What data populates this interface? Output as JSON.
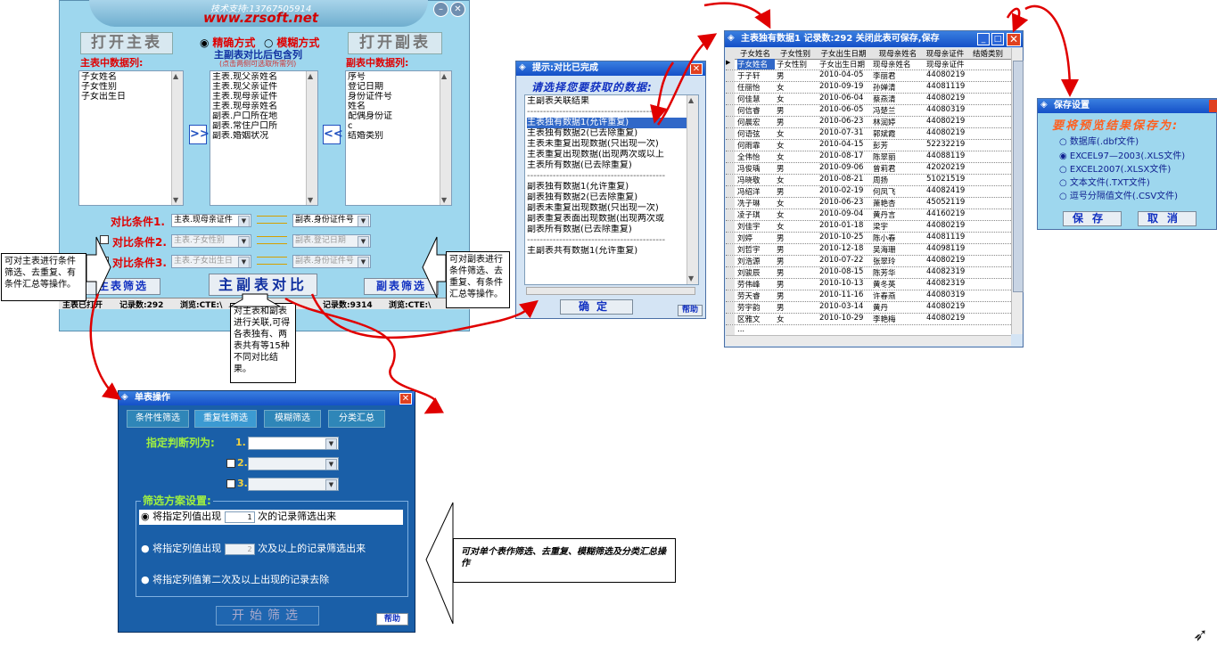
{
  "main": {
    "support_text": "技术支持:13767505914",
    "website": "www.zrsoft.net",
    "open_main": "打开主表",
    "open_sub": "打开副表",
    "mode_exact": "精确方式",
    "mode_fuzzy": "模糊方式",
    "main_cols_label": "主表中数据列:",
    "sub_cols_label": "副表中数据列:",
    "center_label": "主副表对比后包含列",
    "center_hint": "(点击两侧可选取所需列)",
    "main_cols": [
      "子女姓名",
      "子女性别",
      "子女出生日"
    ],
    "center_cols": [
      "主表.现父亲姓名",
      "主表.现父亲证件",
      "主表.现母亲证件",
      "主表.现母亲姓名",
      "副表.户口所在地",
      "副表.常住户口所",
      "副表.婚姻状况"
    ],
    "sub_cols": [
      "序号",
      "登记日期",
      "身份证件号",
      "姓名",
      "配偶身份证",
      "c",
      "结婚类别"
    ],
    "cond1_label": "对比条件1.",
    "cond2_label": "对比条件2.",
    "cond3_label": "对比条件3.",
    "cond1_main": "主表.现母亲证件",
    "cond1_sub": "副表.身份证件号",
    "cond2_main": "主表.子女性别",
    "cond2_sub": "副表.登记日期",
    "cond3_main": "主表.子女出生日",
    "cond3_sub": "副表.身份证件号",
    "main_filter": "主表筛选",
    "compare": "主副表对比",
    "sub_filter": "副表筛选",
    "status_left": "主表已打开",
    "status_left_count": "记录数:292",
    "status_path1": "浏览:CTE:\\",
    "status_right_count": "记录数:9314",
    "status_path2": "浏览:CTE:\\"
  },
  "callouts": {
    "left": "可对主表进行条件筛选、去重复、有条件汇总等操作。",
    "right": "可对副表进行条件筛选、去重复、有条件汇总等操作。",
    "center": "对主表和副表进行关联,可得各表独有、两表共有等15种不同对比结果。",
    "bottom": "可对单个表作筛选、去重复、模糊筛选及分类汇总操作"
  },
  "prompt": {
    "title": "提示:对比已完成",
    "header": "请选择您要获取的数据:",
    "items": [
      "主副表关联结果",
      "-------------------------------------------",
      "主表独有数据1(允许重复)",
      "主表独有数据2(已去除重复)",
      "主表未重复出现数据(只出现一次)",
      "主表重复出现数据(出现两次或以上",
      "主表所有数据(已去除重复)",
      "-------------------------------------------",
      "副表独有数据1(允许重复)",
      "副表独有数据2(已去除重复)",
      "副表未重复出现数据(只出现一次)",
      "副表重复表面出现数据(出现两次或",
      "副表所有数据(已去除重复)",
      "-------------------------------------------",
      "主副表共有数据1(允许重复)"
    ],
    "ok": "确定",
    "help": "帮助"
  },
  "table": {
    "title": "主表独有数据1 记录数:292  关闭此表可保存,保存",
    "headers": [
      "子女姓名",
      "子女性别",
      "子女出生日期",
      "现母亲姓名",
      "现母亲证件",
      "结婚类别"
    ],
    "rows": [
      [
        "子女姓名",
        "子女性别",
        "子女出生日期",
        "现母亲姓名",
        "现母亲证件",
        ""
      ],
      [
        "于子轩",
        "男",
        "2010-04-05",
        "李丽君",
        "44080219",
        ""
      ],
      [
        "任丽怡",
        "女",
        "2010-09-19",
        "孙婵清",
        "44081119",
        ""
      ],
      [
        "何佳慧",
        "女",
        "2010-06-04",
        "蔡燕清",
        "44080219",
        ""
      ],
      [
        "何信睿",
        "男",
        "2010-06-05",
        "冯楚兰",
        "44080319",
        ""
      ],
      [
        "何晨宏",
        "男",
        "2010-06-23",
        "林润婷",
        "44080219",
        ""
      ],
      [
        "何语弦",
        "女",
        "2010-07-31",
        "郭斌霞",
        "44080219",
        ""
      ],
      [
        "何雨霏",
        "女",
        "2010-04-15",
        "彭芳",
        "52232219",
        ""
      ],
      [
        "全伟怡",
        "女",
        "2010-08-17",
        "陈翠丽",
        "44088119",
        ""
      ],
      [
        "冯俊瑀",
        "男",
        "2010-09-06",
        "曾莉君",
        "42020219",
        ""
      ],
      [
        "冯晓敬",
        "女",
        "2010-08-21",
        "周扬",
        "51021519",
        ""
      ],
      [
        "冯绍洋",
        "男",
        "2010-02-19",
        "何凤飞",
        "44082419",
        ""
      ],
      [
        "冼子琳",
        "女",
        "2010-06-23",
        "萧艳杏",
        "45052119",
        ""
      ],
      [
        "凌子琪",
        "女",
        "2010-09-04",
        "黄丹言",
        "44160219",
        ""
      ],
      [
        "刘佳宇",
        "女",
        "2010-01-18",
        "梁宇",
        "44080219",
        ""
      ],
      [
        "刘婷",
        "男",
        "2010-10-25",
        "陈小春",
        "44081119",
        ""
      ],
      [
        "刘哲宇",
        "男",
        "2010-12-18",
        "吴海珊",
        "44098119",
        ""
      ],
      [
        "刘浩源",
        "男",
        "2010-07-22",
        "张翠玲",
        "44080219",
        ""
      ],
      [
        "刘骏辰",
        "男",
        "2010-08-15",
        "陈芳华",
        "44082319",
        ""
      ],
      [
        "劳伟峰",
        "男",
        "2010-10-13",
        "黄冬英",
        "44082319",
        ""
      ],
      [
        "劳天睿",
        "男",
        "2010-11-16",
        "许春燕",
        "44080319",
        ""
      ],
      [
        "劳宇韵",
        "男",
        "2010-03-14",
        "黄丹",
        "44080219",
        ""
      ],
      [
        "区雅文",
        "女",
        "2010-10-29",
        "李艳梅",
        "44080219",
        ""
      ],
      [
        "...",
        "",
        "",
        "",
        "",
        ""
      ]
    ]
  },
  "save": {
    "title": "保存设置",
    "header": "要将预览结果保存为:",
    "options": [
      "数据库(.dbf文件)",
      "EXCEL97—2003(.XLS文件)",
      "EXCEL2007(.XLSX文件)",
      "文本文件(.TXT文件)",
      "逗号分隔值文件(.CSV文件)"
    ],
    "save": "保存",
    "cancel": "取消"
  },
  "single": {
    "title": "单表操作",
    "tabs": [
      "条件性筛选",
      "重复性筛选",
      "模糊筛选",
      "分类汇总"
    ],
    "col_label": "指定判断列为:",
    "n1": "1.",
    "n2": "2.",
    "n3": "3.",
    "scheme_label": "筛选方案设置:",
    "opt1_pre": "将指定列值出现",
    "opt1_val": "1",
    "opt1_post": "次的记录筛选出来",
    "opt2_pre": "将指定列值出现",
    "opt2_val": "2",
    "opt2_post": "次及以上的记录筛选出来",
    "opt3": "将指定列值第二次及以上出现的记录去除",
    "start": "开始筛选",
    "help": "帮助"
  },
  "colors": {
    "panel": "#9ed7ee",
    "dialog_blue": "#1a5fa8",
    "arrow_red": "#e00000"
  }
}
